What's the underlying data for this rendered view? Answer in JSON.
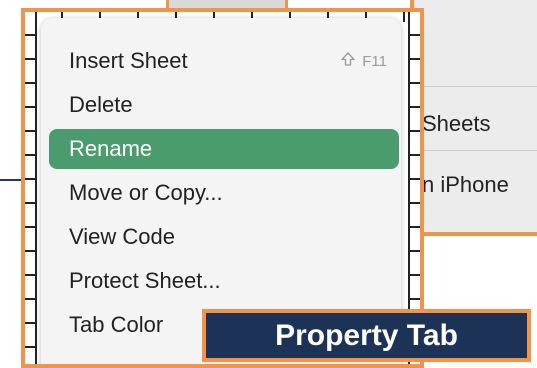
{
  "background": {
    "items": [
      {
        "label": "Sheets"
      },
      {
        "label": "n iPhone"
      }
    ]
  },
  "menu": {
    "items": [
      {
        "label": "Insert Sheet",
        "shortcut": "F11"
      },
      {
        "label": "Delete"
      },
      {
        "label": "Rename",
        "selected": true
      },
      {
        "label": "Move or Copy..."
      },
      {
        "label": "View Code"
      },
      {
        "label": "Protect Sheet..."
      },
      {
        "label": "Tab Color"
      }
    ]
  },
  "callout": {
    "label": "Property Tab"
  },
  "colors": {
    "accent_border": "#f2934a",
    "selection": "#4a9b6e",
    "callout_bg": "#1c3357"
  }
}
